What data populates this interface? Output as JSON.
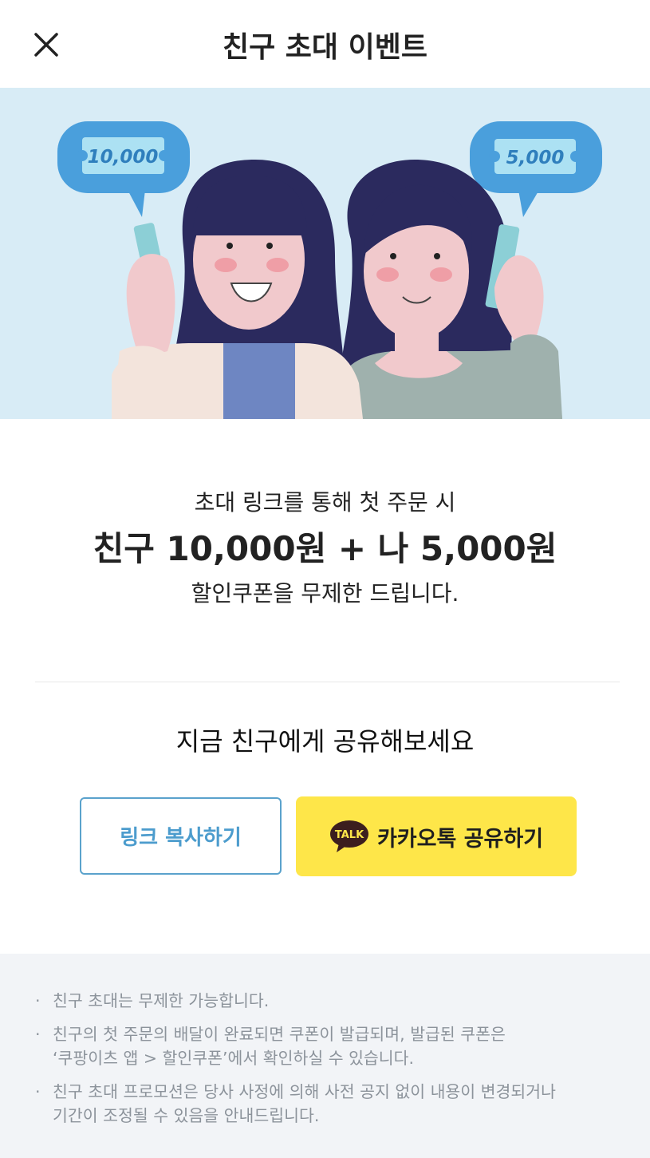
{
  "header": {
    "title": "친구 초대 이벤트",
    "close_icon": "close-icon"
  },
  "hero": {
    "left_bubble_amount": "10,000",
    "right_bubble_amount": "5,000",
    "colors": {
      "background": "#d8ecf6",
      "bubble": "#4a9fdc",
      "hair": "#2b2a5e"
    }
  },
  "promo": {
    "line1": "초대 링크를 통해 첫 주문 시",
    "line2": "친구 10,000원 + 나 5,000원",
    "line3": "할인쿠폰을 무제한 드립니다."
  },
  "share": {
    "title": "지금 친구에게 공유해보세요",
    "copy_link_label": "링크 복사하기",
    "kakao_label": "카카오톡 공유하기",
    "kakao_icon_text": "TALK",
    "colors": {
      "kakao_bg": "#fee649",
      "copy_border": "#5aa2cc"
    }
  },
  "notes": {
    "bullet": "·",
    "items": [
      {
        "line1": "친구 초대는 무제한 가능합니다.",
        "line2": ""
      },
      {
        "line1": "친구의 첫 주문의 배달이 완료되면 쿠폰이 발급되며, 발급된 쿠폰은",
        "line2": "‘쿠팡이츠 앱 > 할인쿠폰’에서 확인하실 수 있습니다."
      },
      {
        "line1": "친구 초대 프로모션은 당사 사정에 의해 사전 공지 없이 내용이 변경되거나",
        "line2": "기간이 조정될 수 있음을 안내드립니다."
      }
    ]
  }
}
